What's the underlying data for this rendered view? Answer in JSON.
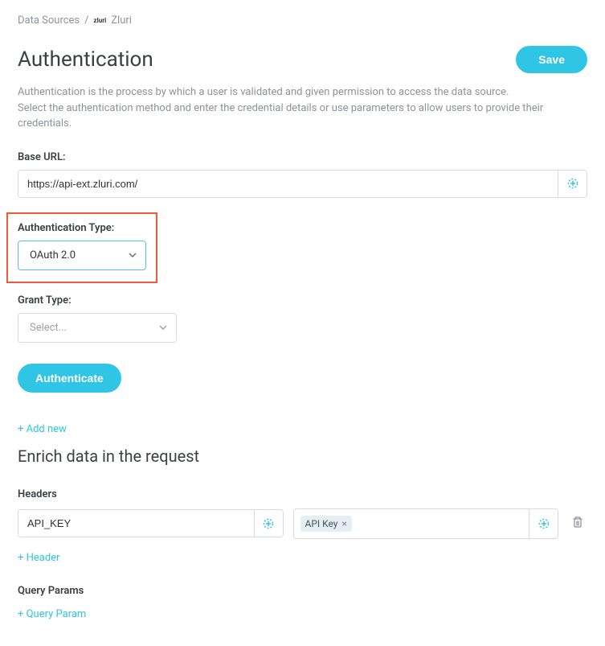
{
  "breadcrumb": {
    "root": "Data Sources",
    "separator": "/",
    "logo_text": "zluri",
    "current": "Zluri"
  },
  "header": {
    "title": "Authentication",
    "save_label": "Save"
  },
  "description": {
    "line1": "Authentication is the process by which a user is validated and given permission to access the data source.",
    "line2": "Select the authentication method and enter the credential details or use parameters to allow users to provide their credentials."
  },
  "base_url": {
    "label": "Base URL:",
    "value": "https://api-ext.zluri.com/"
  },
  "auth_type": {
    "label": "Authentication Type:",
    "value": "OAuth 2.0"
  },
  "grant_type": {
    "label": "Grant Type:",
    "placeholder": "Select..."
  },
  "authenticate_label": "Authenticate",
  "add_new_label": "+ Add new",
  "enrich": {
    "title": "Enrich data in the request",
    "headers_label": "Headers",
    "header_key": "API_KEY",
    "header_value_tag": "API Key",
    "add_header_label": "+ Header",
    "query_params_label": "Query Params",
    "add_query_param_label": "+ Query Param"
  }
}
